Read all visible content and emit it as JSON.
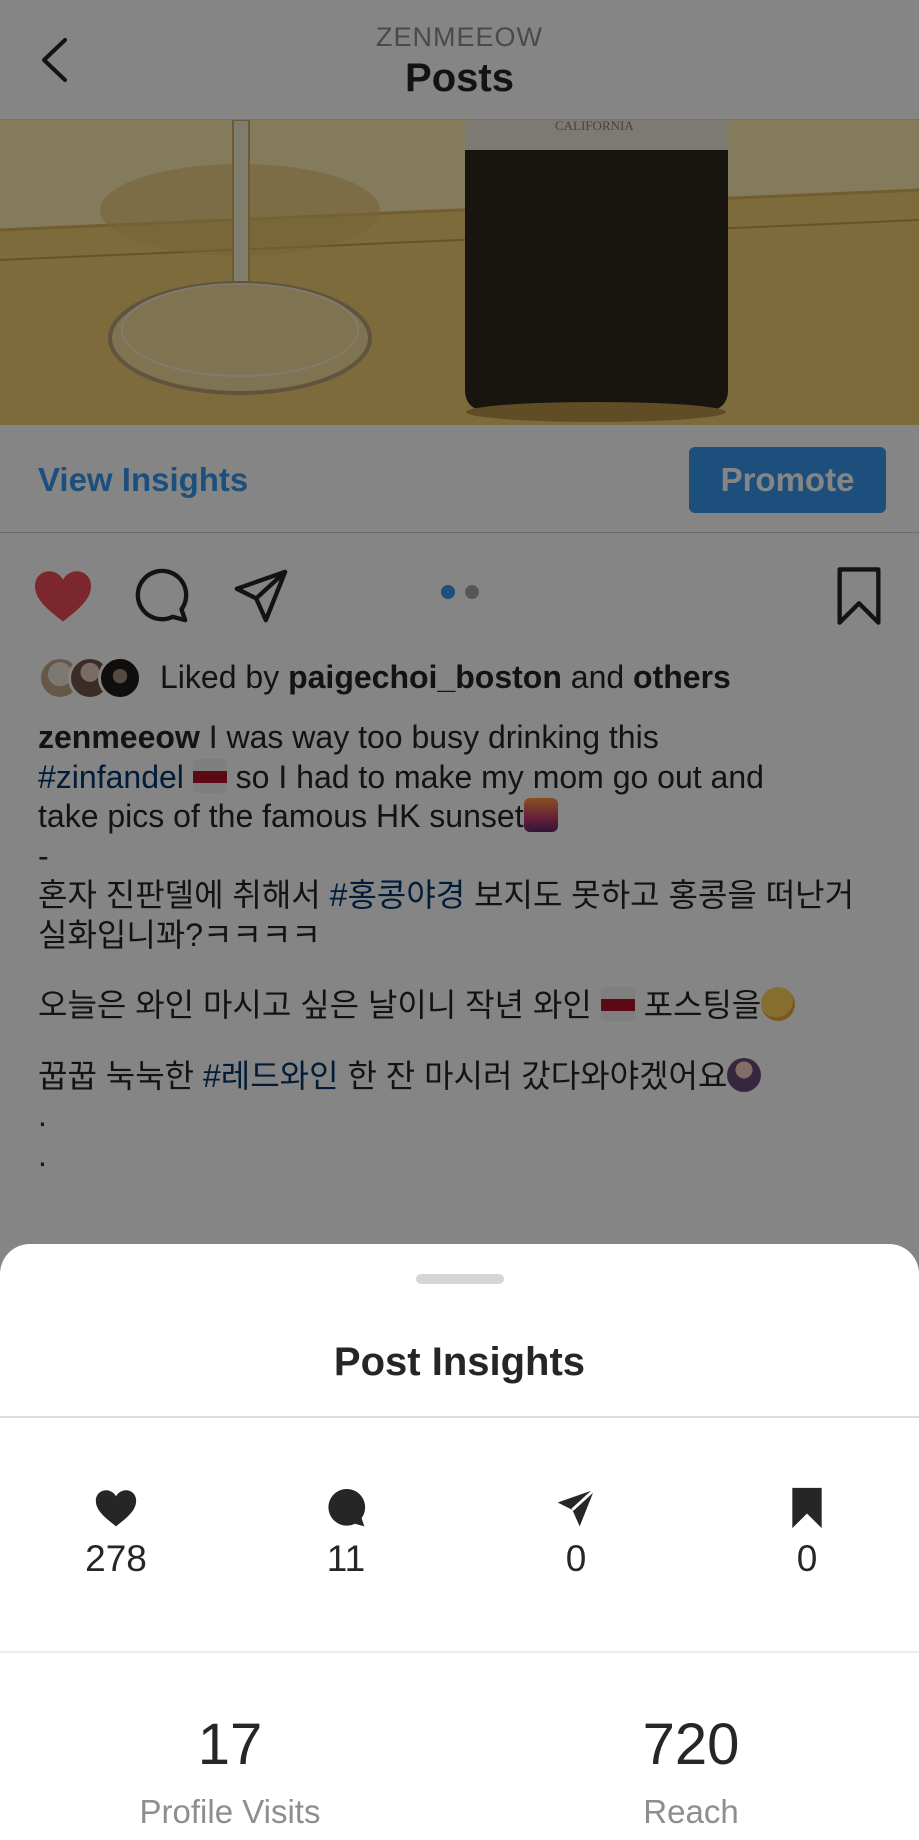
{
  "header": {
    "account_name": "ZENMEEOW",
    "title": "Posts"
  },
  "post": {
    "photo_label": "CALIFORNIA",
    "view_insights_label": "View Insights",
    "promote_label": "Promote",
    "carousel": {
      "total": 2,
      "active_index": 0
    },
    "liked_prefix": "Liked by",
    "liked_user": "paigechoi_boston",
    "liked_and": "and",
    "liked_others": "others",
    "caption": {
      "username": "zenmeeow",
      "line1": "I was way too busy drinking this",
      "tag_zinfandel": "#zinfandel",
      "line2_rest": "so I had to make my mom go out and",
      "line3": "take pics of the famous HK sunset",
      "dash": "-",
      "kr1_pre": "혼자 진판델에 취해서",
      "kr1_tag": "#홍콩야경",
      "kr1_post": "보지도 못하고 홍콩을 떠난거",
      "kr2": "실화입니꽈?ㅋㅋㅋㅋ",
      "kr3_pre": "오늘은 와인 마시고 싶은 날이니 작년 와인",
      "kr3_post": "포스팅을",
      "kr4_pre": "꿉꿉 눅눅한",
      "kr4_tag": "#레드와인",
      "kr4_post": "한 잔 마시러 갔다와야겠어요",
      "dot1": ".",
      "dot2": "."
    }
  },
  "insights_sheet": {
    "title": "Post Insights",
    "metrics": [
      {
        "icon": "heart-icon",
        "value": "278"
      },
      {
        "icon": "comment-icon",
        "value": "11"
      },
      {
        "icon": "send-icon",
        "value": "0"
      },
      {
        "icon": "bookmark-icon",
        "value": "0"
      }
    ],
    "profile_visits": {
      "value": "17",
      "label": "Profile Visits"
    },
    "reach": {
      "value": "720",
      "label": "Reach"
    }
  },
  "colors": {
    "accent_blue": "#3897f0",
    "like_red": "#ed4956",
    "hashtag": "#00376b",
    "overlay": "rgba(0,0,0,0.48)"
  }
}
